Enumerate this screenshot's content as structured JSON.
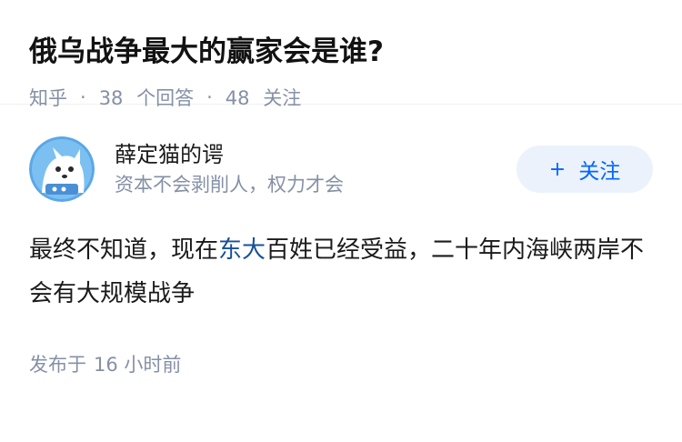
{
  "question": {
    "title": "俄乌战争最大的赢家会是谁?",
    "source": "知乎",
    "answer_count": "38",
    "answer_label": "个回答",
    "follower_count": "48",
    "follower_label": "关注"
  },
  "answer": {
    "author_name": "薛定猫的谔",
    "author_bio": "资本不会剥削人，权力才会",
    "follow_button": {
      "plus": "+",
      "label": "关注"
    },
    "content": {
      "before": "最终不知道，现在",
      "link": "东大",
      "after": "百姓已经受益，二十年内海峡两岸不会有大规模战争"
    },
    "published_prefix": "发布于",
    "published_time": "16 小时前"
  },
  "colors": {
    "accent": "#0066ff",
    "link": "#175199",
    "muted": "#8590a6",
    "follow_bg": "#ebf2fb"
  },
  "icons": {
    "avatar": "cartoon-cat-avatar-icon"
  }
}
